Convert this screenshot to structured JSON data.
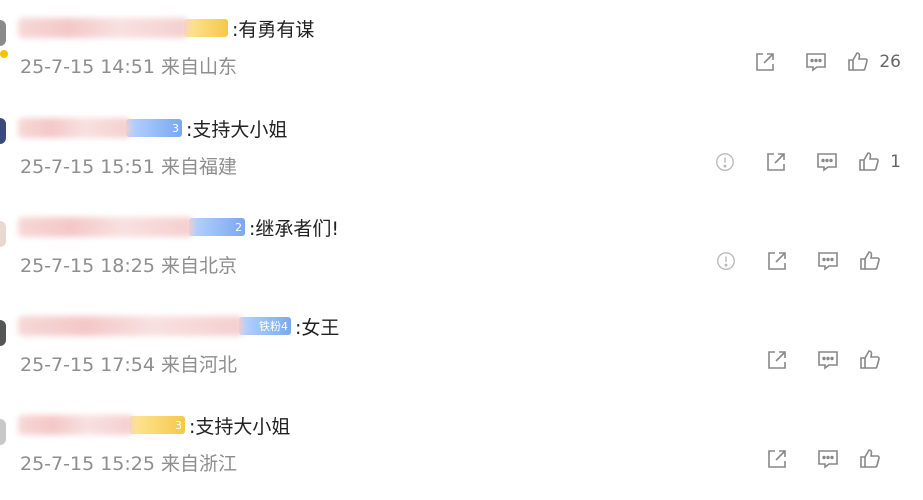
{
  "colors": {
    "meta_text": "#8e8e8e",
    "body_text": "#222222",
    "icon": "#888888"
  },
  "icons": [
    "report-icon",
    "share-icon",
    "comment-icon",
    "like-icon"
  ],
  "comments": [
    {
      "text": ":有勇有谋",
      "meta": "25-7-15 14:51 来自山东",
      "likes": "26",
      "fan_badge": "",
      "badge_color": "gold",
      "report": false
    },
    {
      "text": ":支持大小姐",
      "meta": "25-7-15 15:51 来自福建",
      "likes": "1",
      "fan_badge": "3",
      "badge_color": "blue",
      "report": true
    },
    {
      "text": ":继承者们!",
      "meta": "25-7-15 18:25 来自北京",
      "likes": "",
      "fan_badge": "2",
      "badge_color": "blue",
      "report": true
    },
    {
      "text": ":女王",
      "meta": "25-7-15 17:54 来自河北",
      "likes": "",
      "fan_badge": "铁粉4",
      "badge_color": "blue",
      "report": false
    },
    {
      "text": ":支持大小姐",
      "meta": "25-7-15 15:25 来自浙江",
      "likes": "",
      "fan_badge": "3",
      "badge_color": "gold",
      "report": false
    }
  ]
}
